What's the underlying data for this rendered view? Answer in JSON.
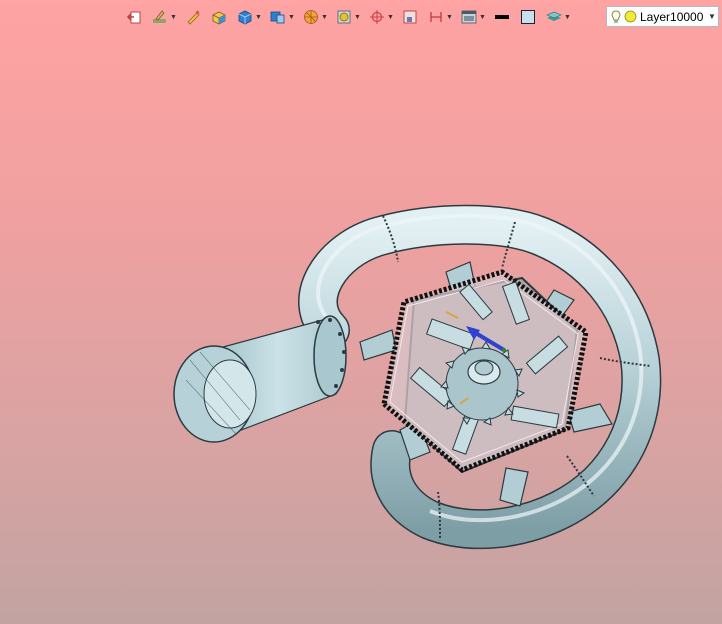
{
  "toolbar": {
    "buttons": [
      {
        "name": "exit-sketch-icon",
        "has_dropdown": false
      },
      {
        "name": "paint-brush-icon",
        "has_dropdown": true
      },
      {
        "name": "pencil-edit-icon",
        "has_dropdown": false
      },
      {
        "name": "yellow-box-icon",
        "has_dropdown": false
      },
      {
        "name": "blue-solid-icon",
        "has_dropdown": true
      },
      {
        "name": "view-orientation-icon",
        "has_dropdown": true
      },
      {
        "name": "render-style-icon",
        "has_dropdown": true
      },
      {
        "name": "hide-show-icon",
        "has_dropdown": true
      },
      {
        "name": "view-origin-icon",
        "has_dropdown": true
      },
      {
        "name": "section-view-icon",
        "has_dropdown": false
      },
      {
        "name": "dimension-icon",
        "has_dropdown": true
      },
      {
        "name": "display-window-icon",
        "has_dropdown": true
      },
      {
        "name": "line-color-icon",
        "has_dropdown": false
      },
      {
        "name": "fill-color-icon",
        "has_dropdown": false
      },
      {
        "name": "layer-stack-icon",
        "has_dropdown": true
      }
    ],
    "layer": {
      "name": "Layer10000"
    }
  },
  "colors": {
    "background_top": "#ffa3a3",
    "background_bottom": "#c2a3a1",
    "model_fill": "#b9d3d9",
    "model_edge": "#2b3a3f"
  }
}
